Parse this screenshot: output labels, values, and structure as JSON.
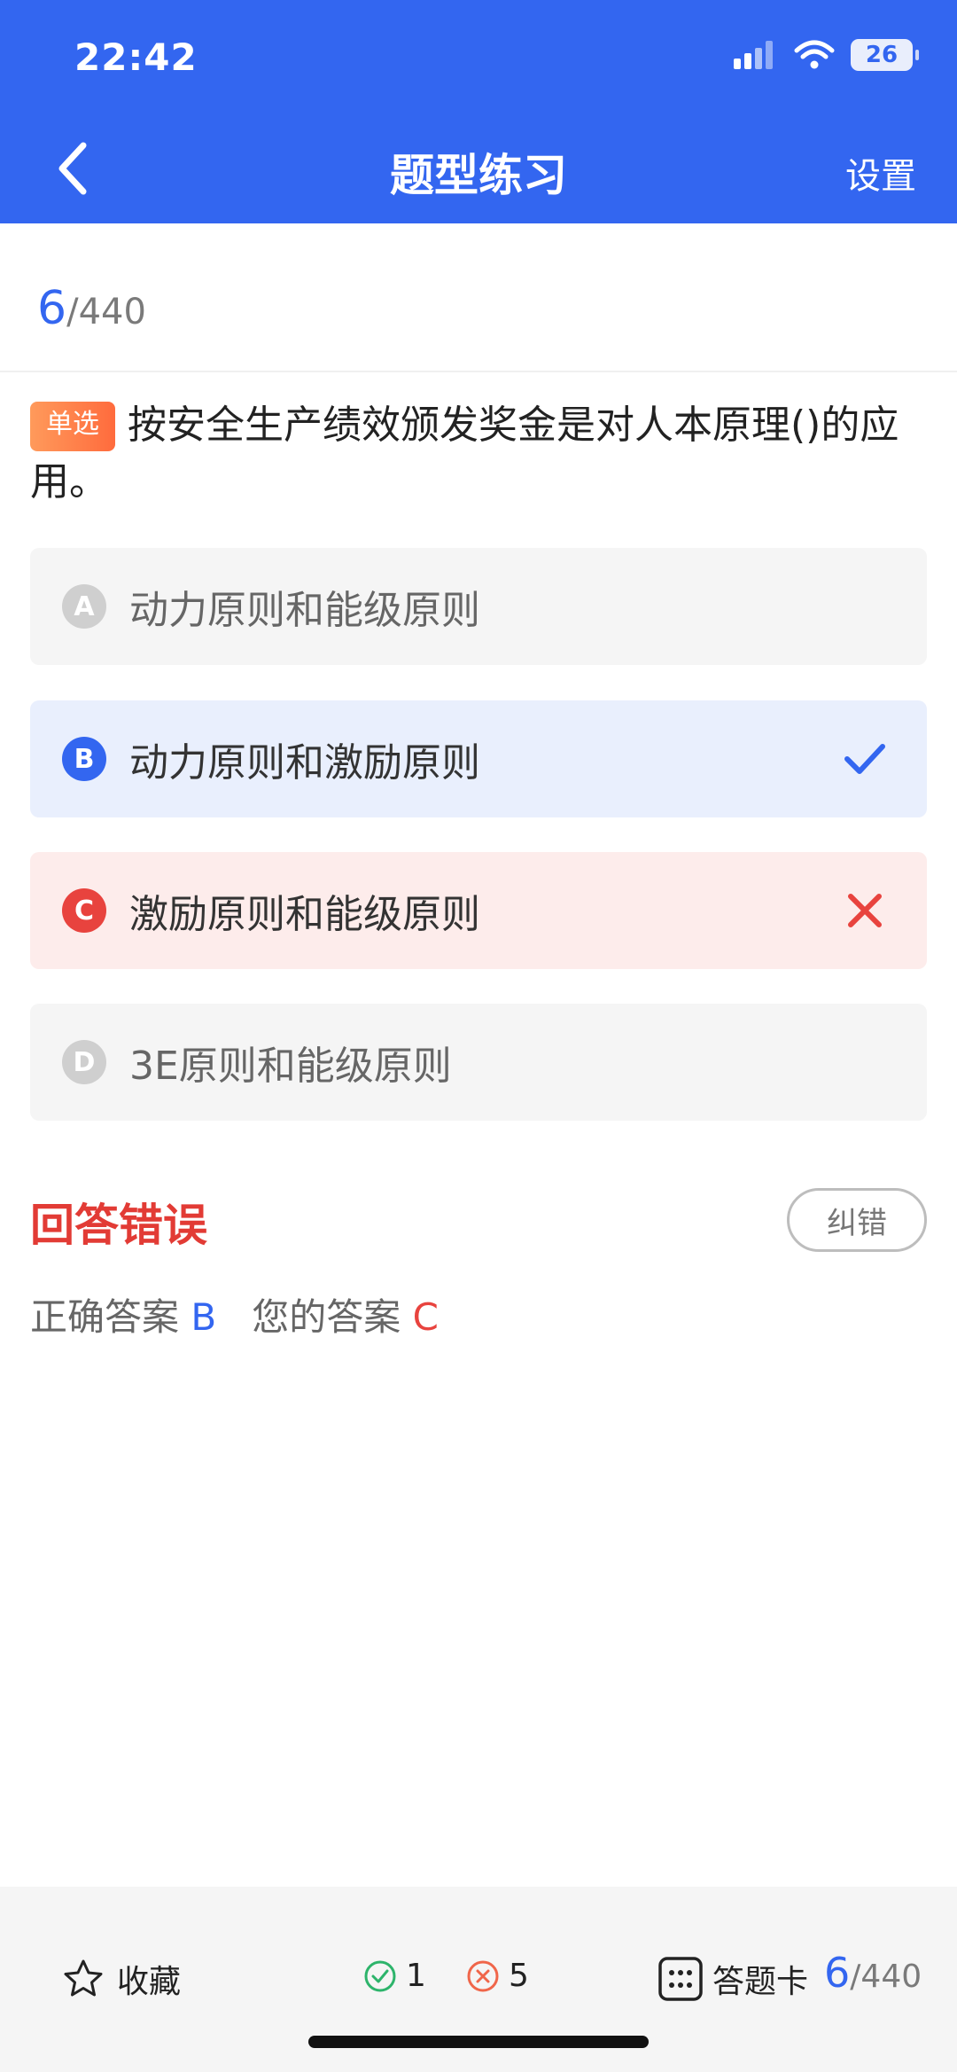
{
  "status": {
    "time": "22:42",
    "battery": "26"
  },
  "header": {
    "title": "题型练习",
    "settings_label": "设置"
  },
  "progress": {
    "current": "6",
    "total": "/440"
  },
  "question": {
    "type_tag": "单选",
    "text": "按安全生产绩效颁发奖金是对人本原理()的应用。"
  },
  "options": [
    {
      "letter": "A",
      "text": "动力原则和能级原则",
      "state": "none"
    },
    {
      "letter": "B",
      "text": "动力原则和激励原则",
      "state": "correct"
    },
    {
      "letter": "C",
      "text": "激励原则和能级原则",
      "state": "wrong"
    },
    {
      "letter": "D",
      "text": "3E原则和能级原则",
      "state": "none"
    }
  ],
  "result": {
    "title": "回答错误",
    "report_label": "纠错",
    "correct_label": "正确答案",
    "correct_value": "B",
    "your_label": "您的答案",
    "your_value": "C"
  },
  "bottom_bar": {
    "favorite_label": "收藏",
    "correct_count": "1",
    "wrong_count": "5",
    "answer_card_label": "答题卡",
    "progress_current": "6",
    "progress_total": "/440"
  },
  "colors": {
    "primary": "#3366F0",
    "error": "#E8433E",
    "success": "#2DB46B"
  },
  "icons": {
    "back": "chevron-left-icon",
    "signal": "signal-icon",
    "wifi": "wifi-icon",
    "check": "check-icon",
    "cross": "cross-icon",
    "star": "star-icon",
    "grid": "grid-icon"
  }
}
